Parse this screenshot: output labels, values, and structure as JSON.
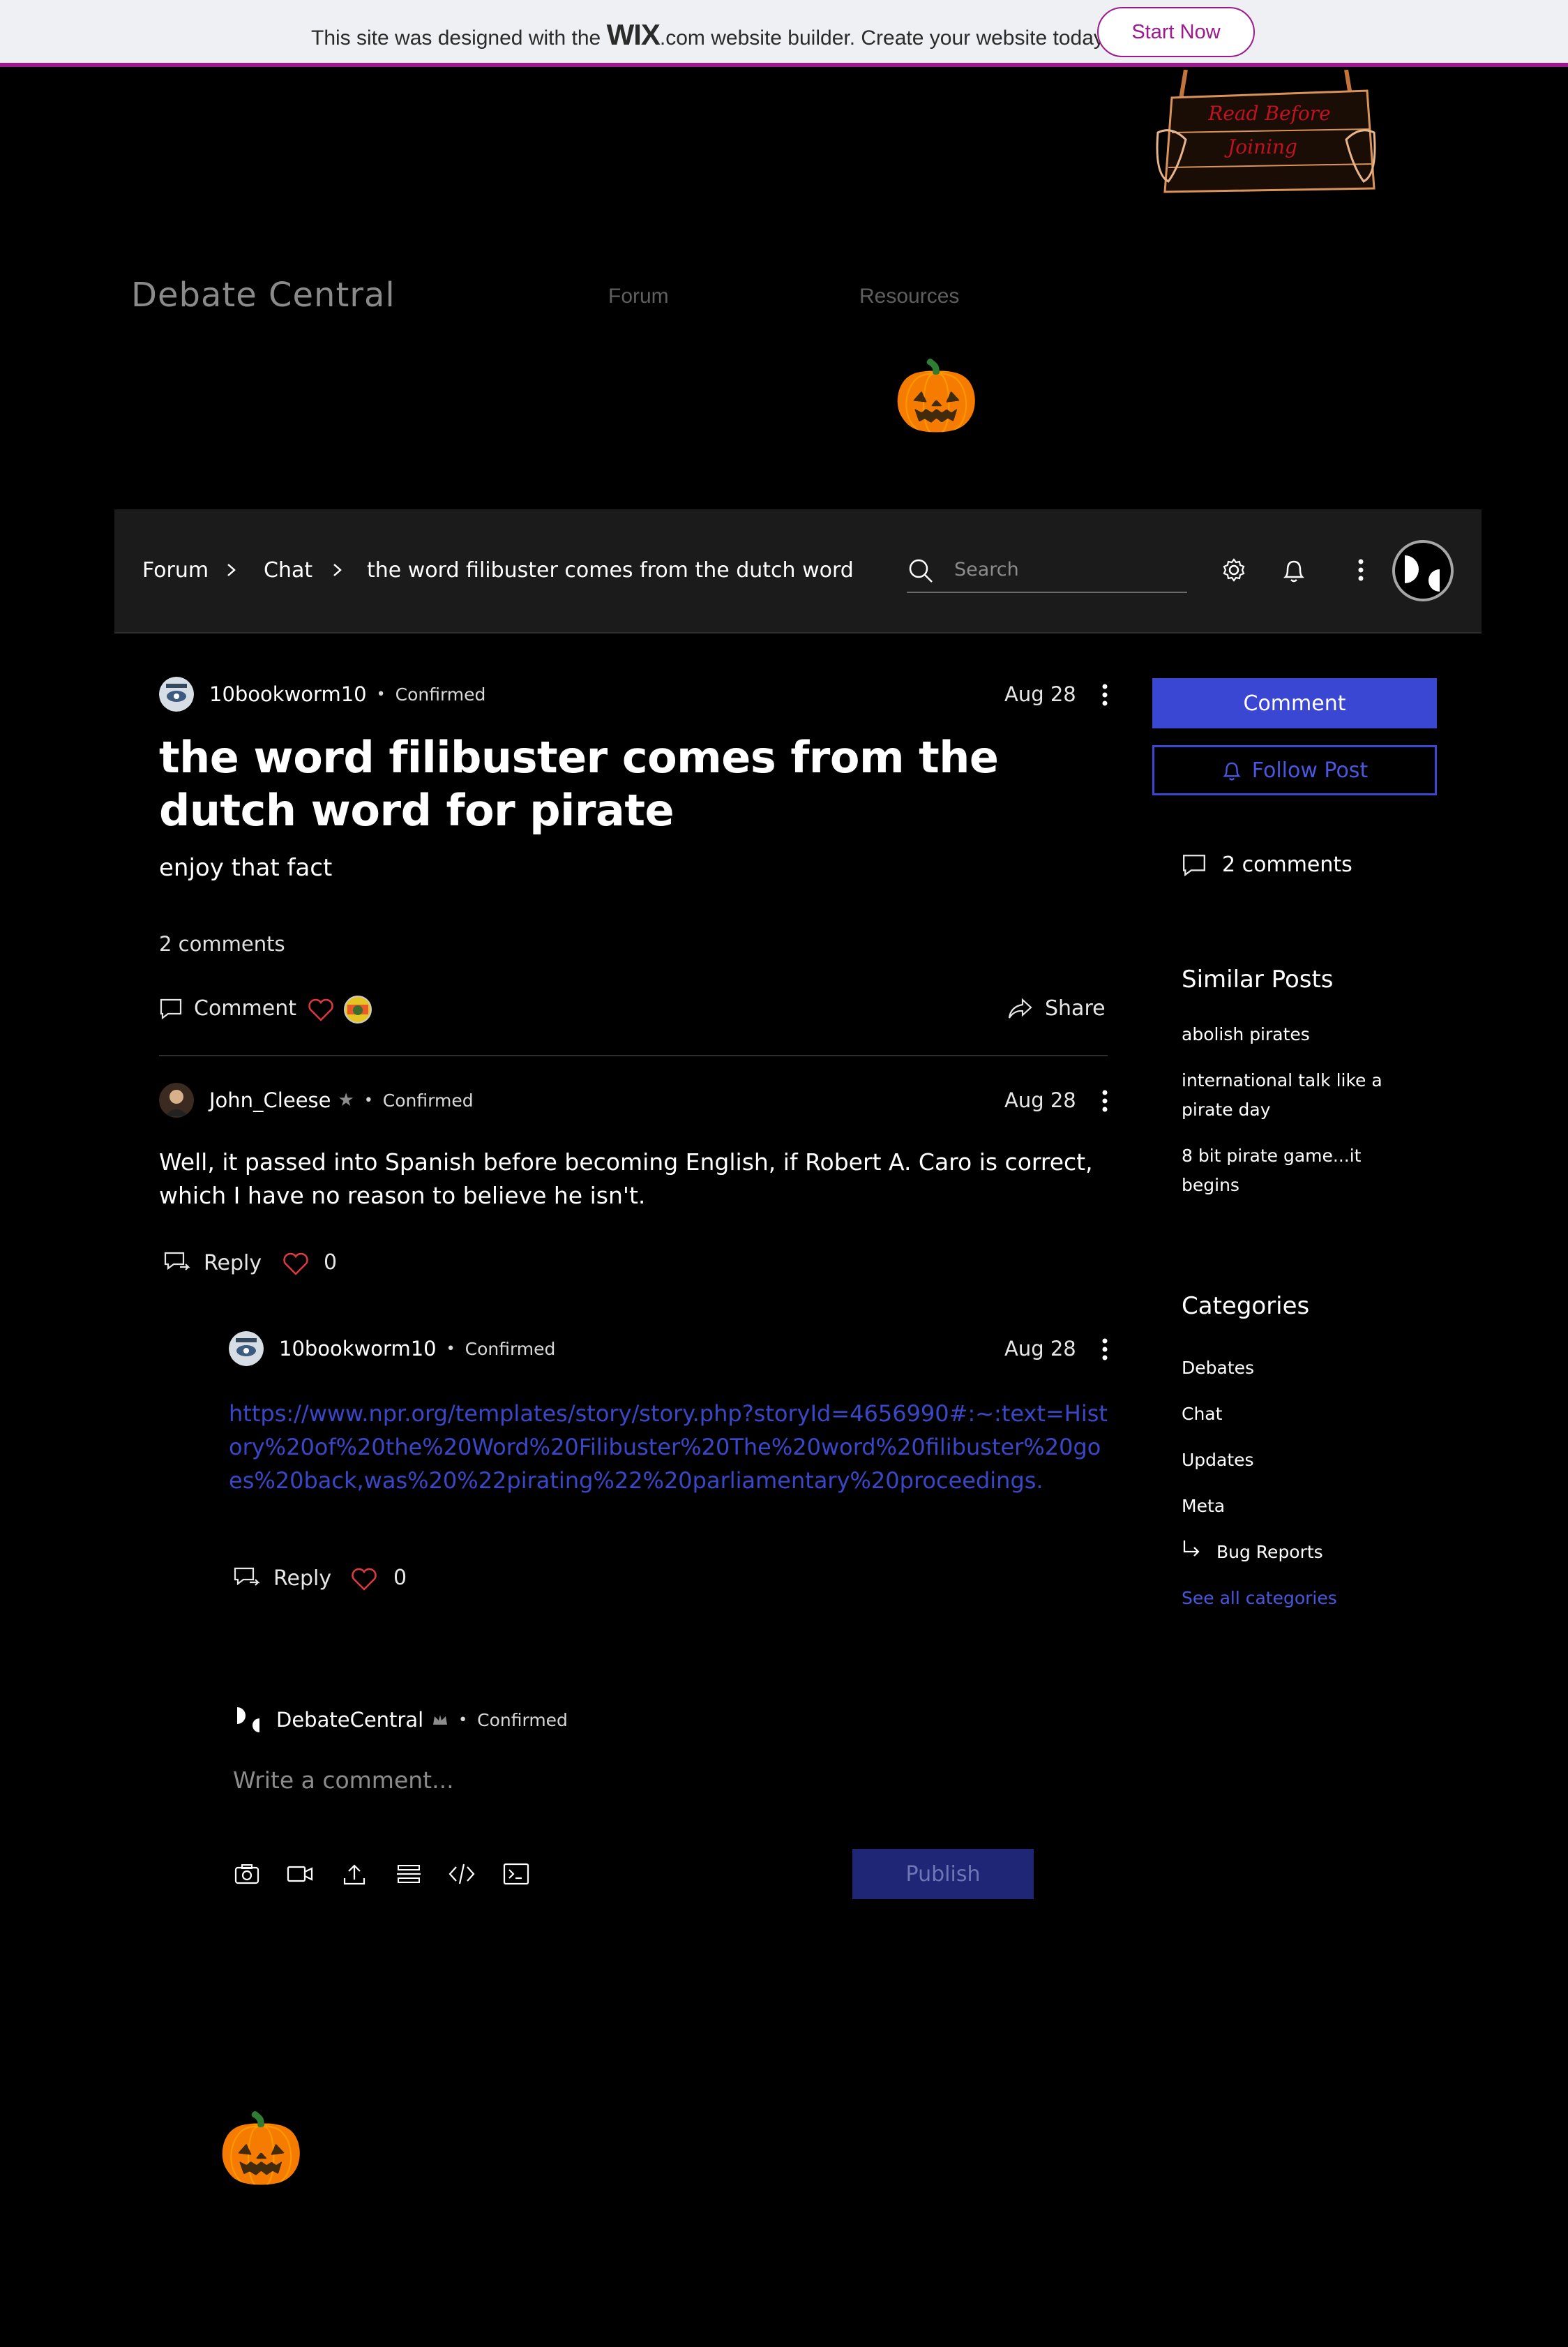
{
  "banner": {
    "text_before": "This site was designed with the",
    "brand": "WIX",
    "brand_suffix": ".com",
    "text_after": "website builder. Create your website today.",
    "cta": "Start Now"
  },
  "header": {
    "sign_text_line1": "Read Before",
    "sign_text_line2": "Joining",
    "site_title": "Debate Central",
    "nav": [
      "Forum",
      "Resources"
    ]
  },
  "forum_bar": {
    "breadcrumbs": [
      "Forum",
      "Chat",
      "the word filibuster comes from the dutch word for..."
    ],
    "search_placeholder": "Search"
  },
  "post": {
    "author": "10bookworm10",
    "badge": "Confirmed",
    "date": "Aug 28",
    "title": "the word filibuster comes from the dutch word for pirate",
    "body": "enjoy that fact",
    "comment_count": "2 comments",
    "actions": {
      "comment": "Comment",
      "share": "Share"
    }
  },
  "comments": [
    {
      "author": "John_Cleese",
      "badge": "Confirmed",
      "date": "Aug 28",
      "text": "Well, it passed into Spanish before becoming English, if Robert A. Caro is correct, which I have no reason to believe he isn't.",
      "reply_label": "Reply",
      "likes": "0"
    }
  ],
  "reply": {
    "author": "10bookworm10",
    "badge": "Confirmed",
    "date": "Aug 28",
    "link": "https://www.npr.org/templates/story/story.php?storyId=4656990#:~:text=History%20of%20the%20Word%20Filibuster%20The%20word%20filibuster%20goes%20back,was%20%22pirating%22%20parliamentary%20proceedings.",
    "reply_label": "Reply",
    "likes": "0"
  },
  "composer": {
    "author": "DebateCentral",
    "badge": "Confirmed",
    "placeholder": "Write a comment...",
    "publish": "Publish"
  },
  "sidebar": {
    "comment_button": "Comment",
    "follow_button": "Follow Post",
    "comments": "2 comments",
    "similar_heading": "Similar Posts",
    "similar_posts": [
      "abolish pirates",
      "international talk like a pirate day",
      "8 bit pirate game...it begins"
    ],
    "categories_heading": "Categories",
    "categories": [
      "Debates",
      "Chat",
      "Updates",
      "Meta"
    ],
    "subcategory": "Bug Reports",
    "see_all": "See all categories"
  },
  "colors": {
    "accent": "#3a47d2",
    "banner_brand": "#9b1a8e",
    "like": "#e0393e",
    "link": "#3a47c8"
  },
  "icons": [
    "search-icon",
    "gear-icon",
    "bell-icon",
    "more-icon",
    "comment-icon",
    "heart-icon",
    "share-icon",
    "reply-icon",
    "camera-icon",
    "video-icon",
    "upload-icon",
    "divider-icon",
    "code-icon",
    "terminal-icon",
    "pumpkin-icon"
  ]
}
